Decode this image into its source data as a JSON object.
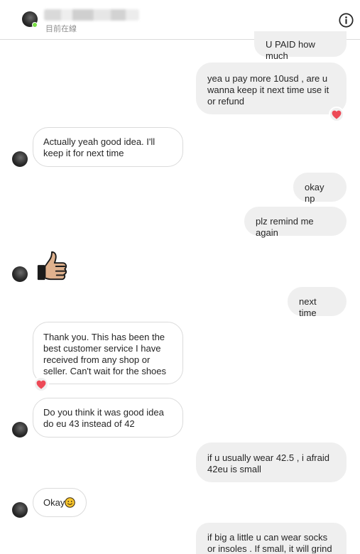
{
  "header": {
    "status": "目前在線",
    "info_icon": "info-circle-icon",
    "online_color": "#78de45"
  },
  "messages": [
    {
      "id": "m1",
      "dir": "out",
      "text": "U PAID how much"
    },
    {
      "id": "m2",
      "dir": "out",
      "text": "yea u pay more 10usd , are u wanna keep it next time use it or refund",
      "reaction": "red-heart"
    },
    {
      "id": "m3",
      "dir": "in",
      "text": "Actually yeah good idea. I'll keep it for next time"
    },
    {
      "id": "m4",
      "dir": "out",
      "text": "okay np"
    },
    {
      "id": "m5",
      "dir": "out",
      "text": "plz remind me again"
    },
    {
      "id": "m6",
      "dir": "in",
      "emoji": "thumbs-up"
    },
    {
      "id": "m7",
      "dir": "out",
      "text": "next time"
    },
    {
      "id": "m8",
      "dir": "in",
      "text": "Thank you. This has been the best customer service I have received from any shop or seller. Can't wait for the shoes",
      "reaction": "red-heart"
    },
    {
      "id": "m9",
      "dir": "in",
      "text": "Do you think it was good idea do eu 43 instead of 42"
    },
    {
      "id": "m10",
      "dir": "out",
      "text": "if u usually wear 42.5 , i afraid 42eu is small"
    },
    {
      "id": "m11",
      "dir": "in",
      "text": "Okay",
      "emoji": "smiling-face"
    },
    {
      "id": "m12",
      "dir": "out",
      "text": "if big a little u can wear socks or insoles . If small, it will grind"
    }
  ],
  "colors": {
    "outgoing_bubble": "#efefef",
    "incoming_border": "#dbdbdb",
    "heart": "#ed4956"
  }
}
